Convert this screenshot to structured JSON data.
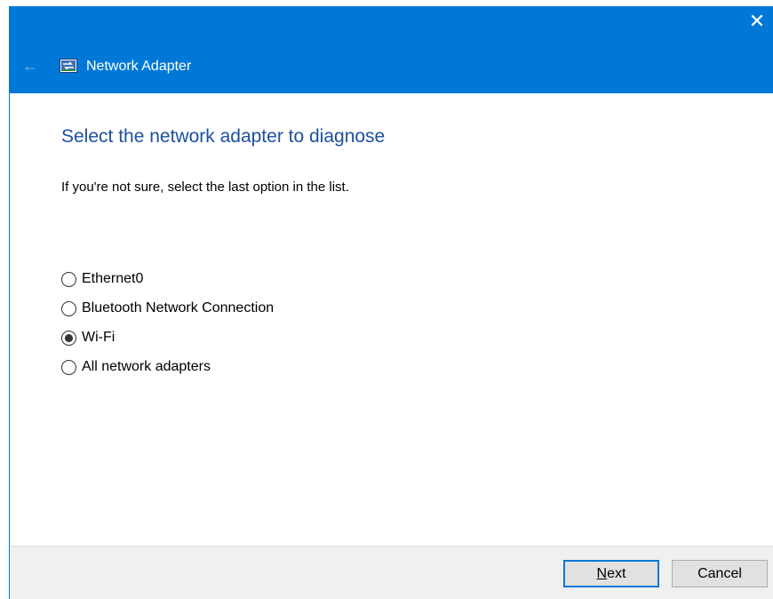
{
  "window": {
    "title": "Network Adapter",
    "close_glyph": "✕",
    "back_glyph": "←",
    "accent_color": "#0078d7",
    "icons": [
      "close-icon",
      "back-arrow-icon",
      "network-adapter-icon"
    ]
  },
  "main": {
    "heading": "Select the network adapter to diagnose",
    "instruction": "If you're not sure, select the last option in the list.",
    "options": [
      {
        "label": "Ethernet0",
        "selected": false
      },
      {
        "label": "Bluetooth Network Connection",
        "selected": false
      },
      {
        "label": "Wi-Fi",
        "selected": true
      },
      {
        "label": "All network adapters",
        "selected": false
      }
    ]
  },
  "footer": {
    "next_mnemonic": "N",
    "next_rest": "ext",
    "cancel_label": "Cancel"
  }
}
